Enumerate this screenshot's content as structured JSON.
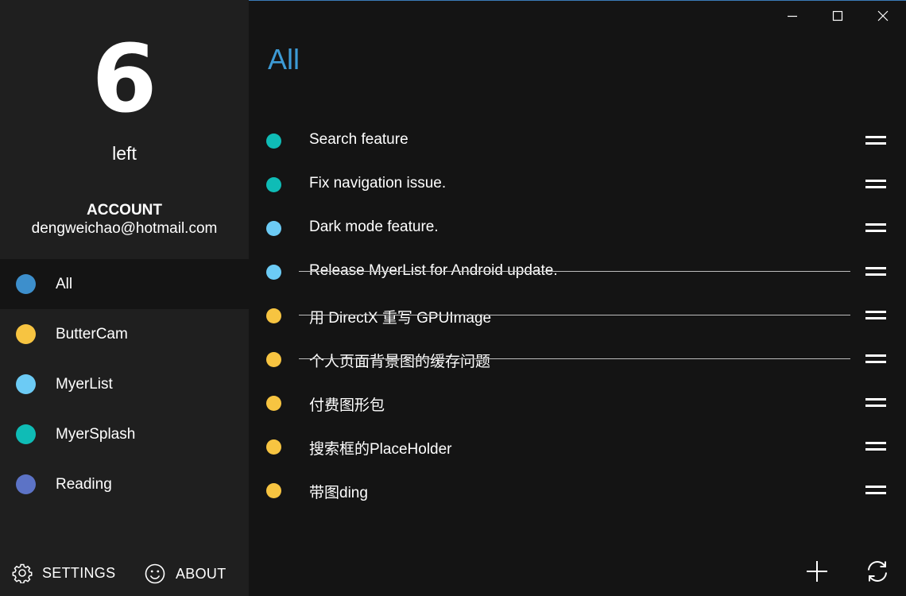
{
  "sidebar": {
    "count": "6",
    "count_label": "left",
    "account_label": "ACCOUNT",
    "account_email": "dengweichao@hotmail.com",
    "categories": [
      {
        "label": "All",
        "color": "#3d8fcc",
        "selected": true
      },
      {
        "label": "ButterCam",
        "color": "#f7c441",
        "selected": false
      },
      {
        "label": "MyerList",
        "color": "#6ccbf5",
        "selected": false
      },
      {
        "label": "MyerSplash",
        "color": "#0fbcb6",
        "selected": false
      },
      {
        "label": "Reading",
        "color": "#5c73c6",
        "selected": false
      }
    ],
    "settings_label": "SETTINGS",
    "about_label": "ABOUT"
  },
  "window_controls": {
    "minimize_icon": "minimize-icon",
    "maximize_icon": "maximize-icon",
    "close_icon": "close-icon"
  },
  "main": {
    "title": "All",
    "title_color": "#3d9bd6",
    "todos": [
      {
        "text": "Search feature",
        "color": "#0fbcb6",
        "done": false
      },
      {
        "text": "Fix navigation issue.",
        "color": "#0fbcb6",
        "done": false
      },
      {
        "text": "Dark mode feature.",
        "color": "#6ccbf5",
        "done": false
      },
      {
        "text": "Release MyerList for Android update.",
        "color": "#6ccbf5",
        "done": true
      },
      {
        "text": "用 DirectX 重写 GPUImage",
        "color": "#f7c441",
        "done": true
      },
      {
        "text": "个人页面背景图的缓存问题",
        "color": "#f7c441",
        "done": true
      },
      {
        "text": "付费图形包",
        "color": "#f7c441",
        "done": false
      },
      {
        "text": "搜索框的PlaceHolder",
        "color": "#f7c441",
        "done": false
      },
      {
        "text": "带图ding",
        "color": "#f7c441",
        "done": false
      }
    ],
    "add_icon": "plus-icon",
    "sync_icon": "sync-icon"
  }
}
